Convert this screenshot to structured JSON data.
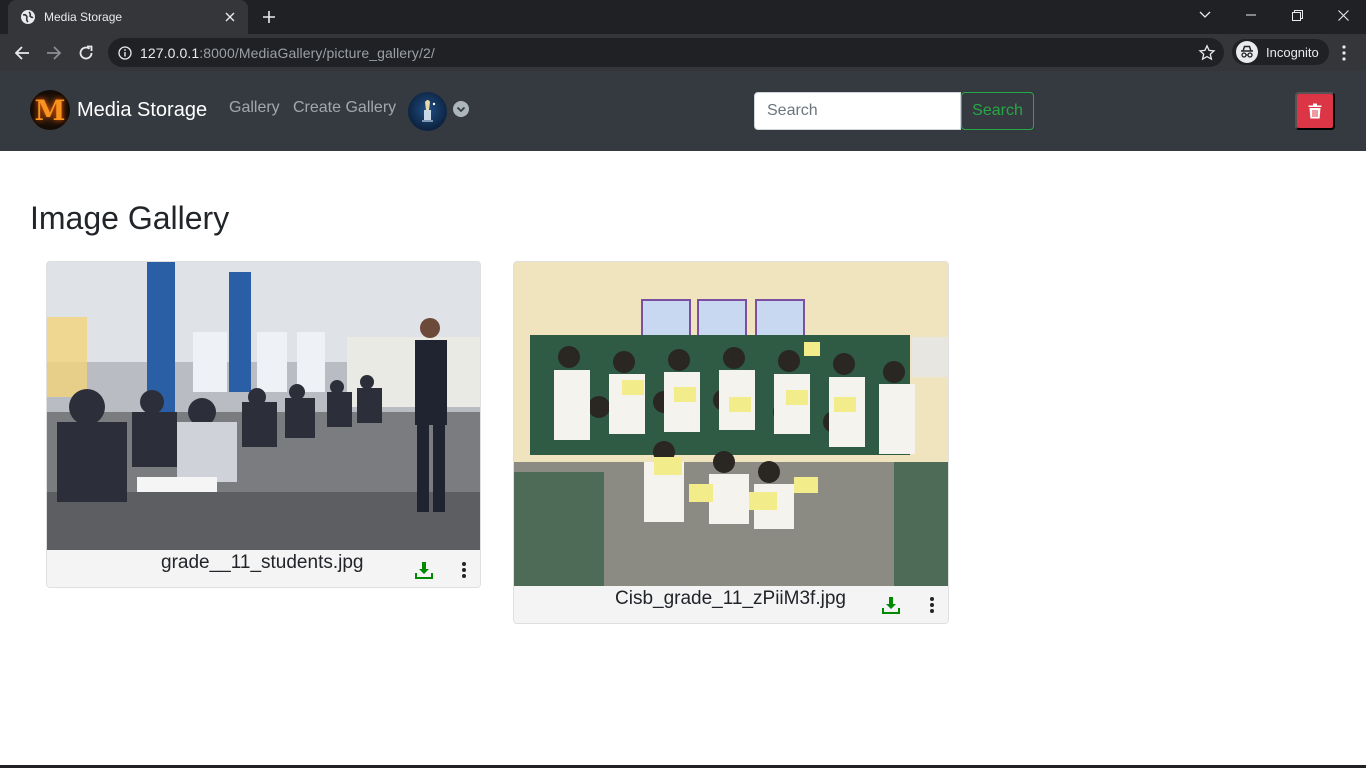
{
  "browser": {
    "tab_title": "Media Storage",
    "url_host": "127.0.0.1",
    "url_rest": ":8000/MediaGallery/picture_gallery/2/",
    "profile_label": "Incognito"
  },
  "navbar": {
    "brand": "Media Storage",
    "links": [
      "Gallery",
      "Create Gallery"
    ],
    "search_placeholder": "Search",
    "search_button": "Search",
    "colors": {
      "background": "#343a40",
      "search_button": "#28a745",
      "delete_button": "#dc3545"
    }
  },
  "main": {
    "title": "Image Gallery",
    "images": [
      {
        "filename": "grade__11_students.jpg"
      },
      {
        "filename": "Cisb_grade_11_zPiiM3f.jpg"
      }
    ]
  },
  "icons": [
    "globe-icon",
    "close-icon",
    "plus-icon",
    "back-arrow-icon",
    "forward-arrow-icon",
    "reload-icon",
    "info-icon",
    "star-icon",
    "incognito-icon",
    "chevron-down-icon",
    "trash-icon",
    "download-icon",
    "more-vert-icon"
  ]
}
